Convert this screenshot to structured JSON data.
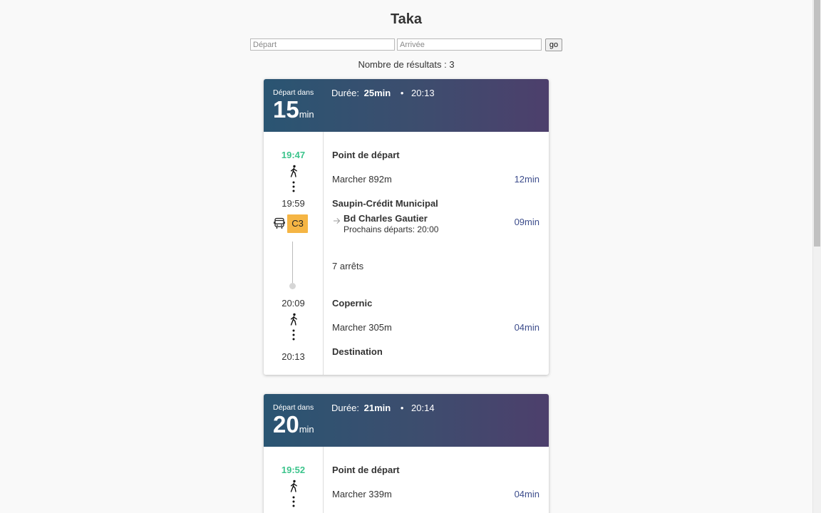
{
  "app": {
    "title": "Taka"
  },
  "search": {
    "from_placeholder": "Départ",
    "to_placeholder": "Arrivée",
    "from_value": "",
    "to_value": "",
    "go_label": "go"
  },
  "results": {
    "count_text": "Nombre de résultats : 3"
  },
  "colors": {
    "now_time": "#3cc48c",
    "duration_text": "#3d4d8c",
    "line_badge": "#f5b544",
    "header_gradient_start": "#2a5572",
    "header_gradient_end": "#4d3f6c"
  },
  "icons": {
    "walk": "walking-person-icon",
    "more": "vertical-dots-icon",
    "bus": "bus-icon",
    "direction": "arrow-right-icon"
  },
  "itineraries": [
    {
      "departure_label": "Départ dans",
      "departure_value": "15",
      "departure_unit": "min",
      "duration_label": "Durée:",
      "duration_value": "25min",
      "separator": "•",
      "arrival_time": "20:13",
      "times": {
        "start": "19:47",
        "board": "19:59",
        "alight": "20:09",
        "end": "20:13"
      },
      "line": "C3",
      "steps": {
        "start_title": "Point de départ",
        "walk1_text": "Marcher 892m",
        "walk1_duration": "12min",
        "board_stop": "Saupin-Crédit Municipal",
        "direction": "Bd Charles Gautier",
        "next_departures": "Prochains départs: 20:00",
        "ride_duration": "09min",
        "stops_count": "7 arrêts",
        "alight_stop": "Copernic",
        "walk2_text": "Marcher 305m",
        "walk2_duration": "04min",
        "end_title": "Destination"
      }
    },
    {
      "departure_label": "Départ dans",
      "departure_value": "20",
      "departure_unit": "min",
      "duration_label": "Durée:",
      "duration_value": "21min",
      "separator": "•",
      "arrival_time": "20:14",
      "times": {
        "start": "19:52"
      },
      "steps": {
        "start_title": "Point de départ",
        "walk1_text": "Marcher 339m",
        "walk1_duration": "04min"
      }
    }
  ]
}
